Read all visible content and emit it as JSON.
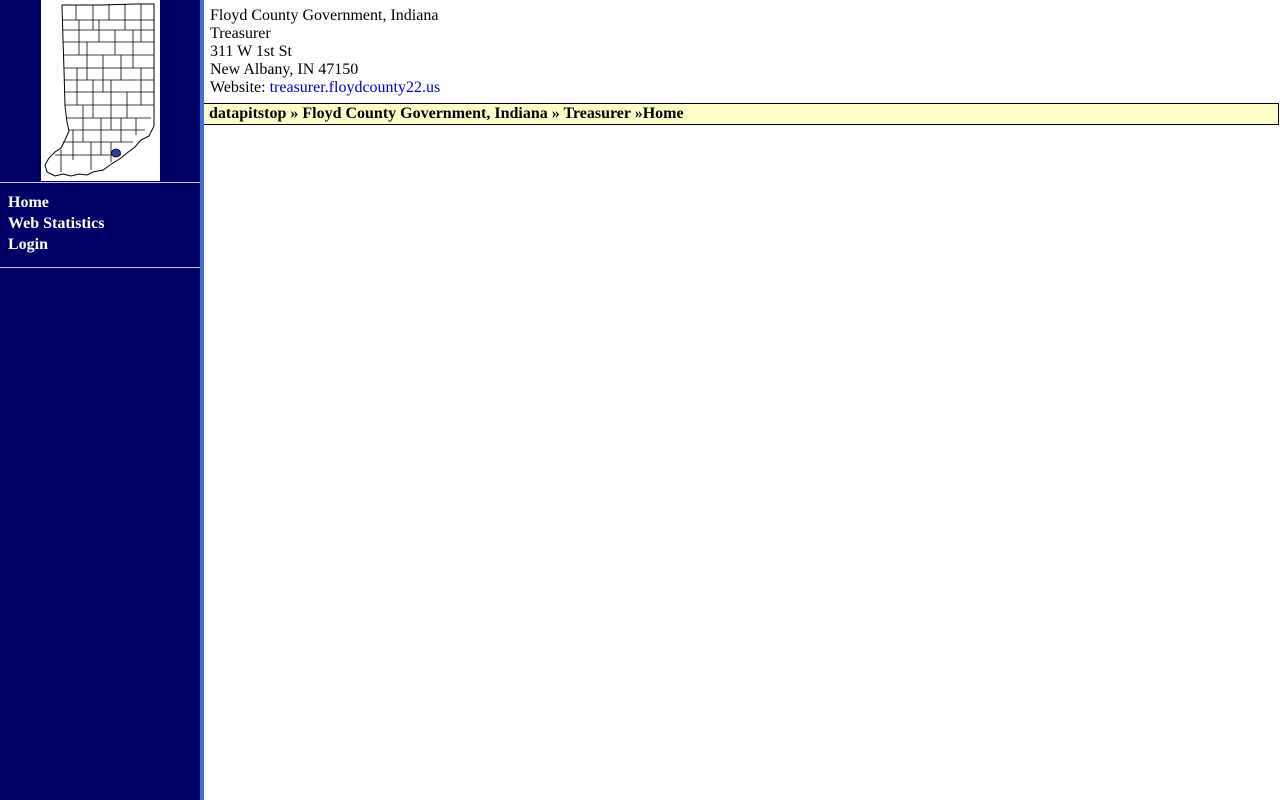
{
  "address": {
    "org_name": "Floyd County Government, Indiana",
    "department": "Treasurer",
    "street": "311 W 1st St",
    "city_state_zip": "New Albany, IN 47150",
    "website_label": "Website:",
    "website_link": "treasurer.floydcounty22.us"
  },
  "nav": {
    "items": [
      {
        "label": "Home"
      },
      {
        "label": "Web Statistics"
      },
      {
        "label": "Login"
      }
    ]
  },
  "breadcrumb": {
    "items": [
      "datapitstop",
      "Floyd County Government, Indiana",
      "Treasurer",
      "Home"
    ],
    "separator": "»"
  },
  "colors": {
    "sidebar": "#000066",
    "sidebar_edge": "#3f6fd8",
    "breadcrumb_bg": "#ffffcc",
    "link": "#0000cc",
    "county_marker": "#2a3fa0"
  },
  "icons": {
    "map": "indiana-county-map-icon"
  }
}
